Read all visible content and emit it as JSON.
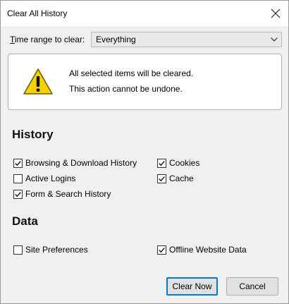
{
  "window": {
    "title": "Clear All History"
  },
  "time_range": {
    "label": "Time range to clear:",
    "selected": "Everything"
  },
  "warning": {
    "line1": "All selected items will be cleared.",
    "line2": "This action cannot be undone."
  },
  "history": {
    "heading": "History",
    "items": [
      {
        "label": "Browsing & Download History",
        "checked": true
      },
      {
        "label": "Cookies",
        "checked": true
      },
      {
        "label": "Active Logins",
        "checked": false
      },
      {
        "label": "Cache",
        "checked": true
      },
      {
        "label": "Form & Search History",
        "checked": true
      }
    ]
  },
  "data_section": {
    "heading": "Data",
    "items": [
      {
        "label": "Site Preferences",
        "checked": false
      },
      {
        "label": "Offline Website Data",
        "checked": true
      }
    ]
  },
  "buttons": {
    "clear_now": "Clear Now",
    "cancel": "Cancel"
  },
  "colors": {
    "accent": "#0078d7",
    "warning_fill": "#f4d100"
  },
  "icons": {
    "close": "close-icon",
    "dropdown": "chevron-down-icon",
    "warning": "warning-icon",
    "check": "check-icon"
  }
}
